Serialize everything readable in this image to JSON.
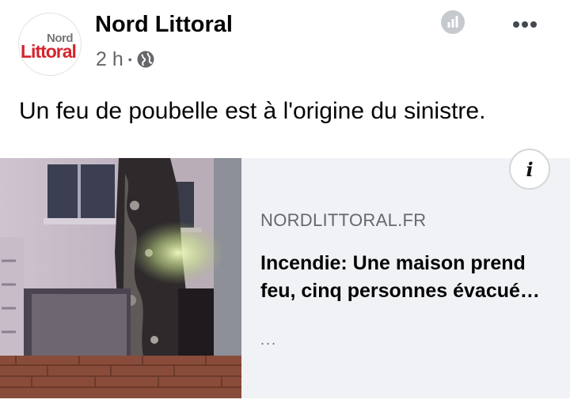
{
  "post": {
    "avatar": {
      "logo_top": "Nord",
      "logo_main": "Littoral"
    },
    "page_name": "Nord Littoral",
    "time": "2 h",
    "separator": "•",
    "caption": "Un feu de poubelle est à l'origine du sinistre."
  },
  "icons": {
    "insights": "insights-icon",
    "more": "more-options-icon",
    "privacy": "globe-icon",
    "info": "info-icon"
  },
  "link_card": {
    "info_glyph": "i",
    "domain": "NORDLITTORAL.FR",
    "headline_line1": "Incendie: Une maison prend",
    "headline_line2": "feu, cinq personnes évacué…",
    "description": "..."
  },
  "colors": {
    "brand_red": "#d6242e",
    "meta_gray": "#65676b",
    "card_background": "#f0f2f5"
  }
}
